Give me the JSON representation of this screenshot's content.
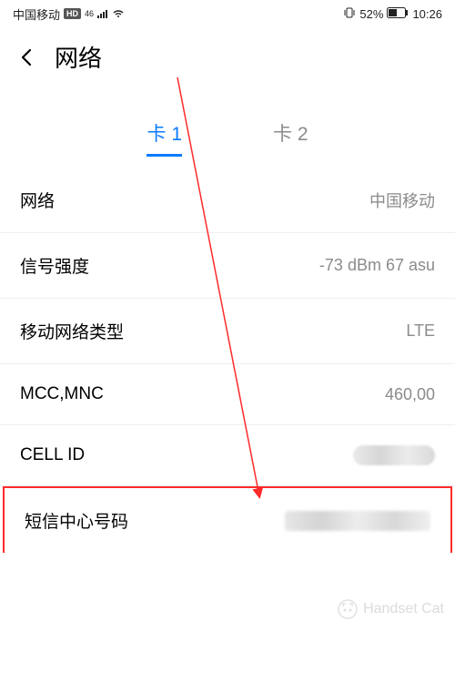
{
  "statusbar": {
    "carrier": "中国移动",
    "hd": "HD",
    "net": "46",
    "battery_pct": "52%",
    "time": "10:26"
  },
  "header": {
    "title": "网络"
  },
  "tabs": {
    "card1": "卡 1",
    "card2": "卡 2"
  },
  "rows": {
    "network": {
      "label": "网络",
      "value": "中国移动"
    },
    "signal": {
      "label": "信号强度",
      "value": "-73 dBm   67 asu"
    },
    "nettype": {
      "label": "移动网络类型",
      "value": "LTE"
    },
    "mccmnc": {
      "label": "MCC,MNC",
      "value": "460,00"
    },
    "cellid": {
      "label": "CELL ID"
    },
    "smscenter": {
      "label": "短信中心号码"
    }
  },
  "watermark": {
    "text": "Handset Cat"
  },
  "colors": {
    "accent": "#0a7bff",
    "highlight": "#ff2a2a"
  }
}
